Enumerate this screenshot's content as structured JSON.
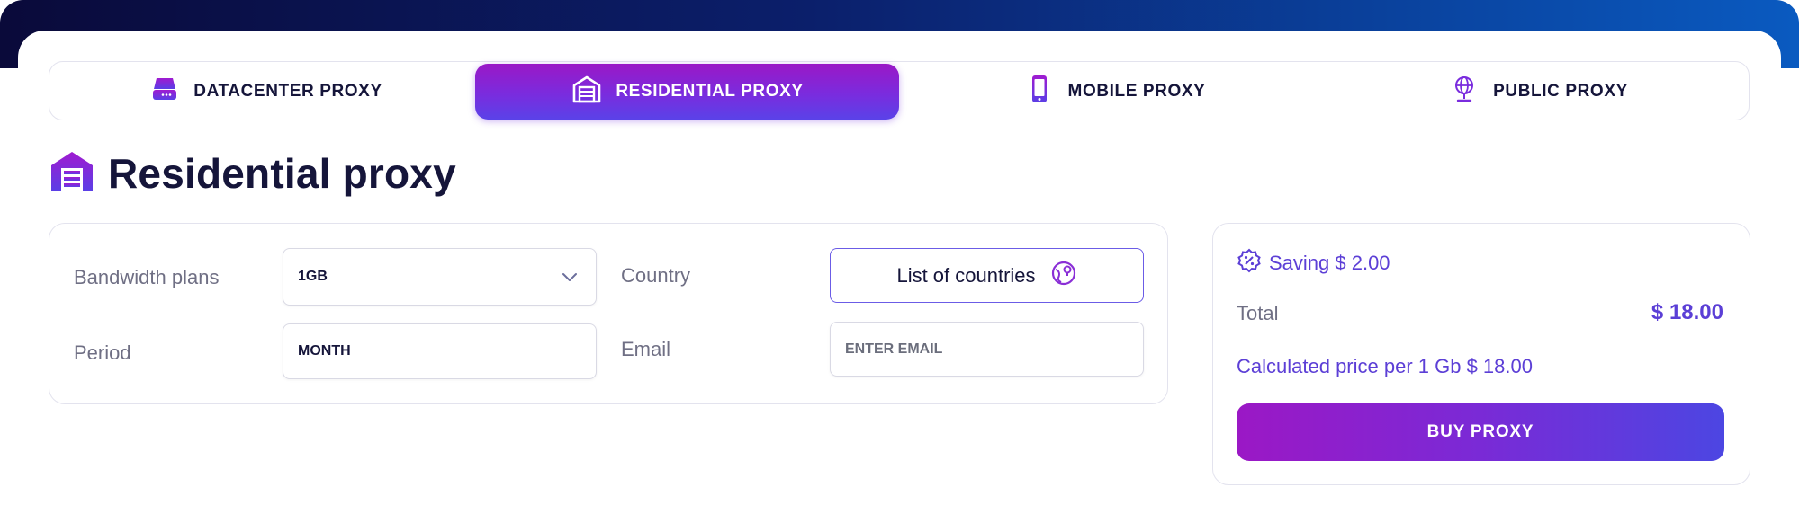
{
  "tabs": [
    {
      "label": "DATACENTER PROXY",
      "icon": "server-icon",
      "active": false
    },
    {
      "label": "RESIDENTIAL PROXY",
      "icon": "warehouse-icon",
      "active": true
    },
    {
      "label": "MOBILE PROXY",
      "icon": "mobile-phone-icon",
      "active": false
    },
    {
      "label": "PUBLIC PROXY",
      "icon": "globe-stand-icon",
      "active": false
    }
  ],
  "page": {
    "title": "Residential proxy",
    "title_icon": "warehouse-icon"
  },
  "form": {
    "bandwidth_label": "Bandwidth plans",
    "bandwidth_value": "1GB",
    "period_label": "Period",
    "period_value": "MONTH",
    "country_label": "Country",
    "country_button": "List of countries",
    "email_label": "Email",
    "email_placeholder": "ENTER EMAIL"
  },
  "summary": {
    "saving": "Saving $ 2.00",
    "total_label": "Total",
    "total_value": "$ 18.00",
    "calc_price": "Calculated price per 1 Gb $ 18.00",
    "buy_label": "BUY PROXY"
  },
  "colors": {
    "accent_purple": "#7a2cde",
    "accent_violet": "#5b3fd6",
    "header_dark": "#0a0a3a",
    "header_blue": "#0a5ac0",
    "text_dark": "#15153a",
    "text_muted": "#6f6f84"
  }
}
